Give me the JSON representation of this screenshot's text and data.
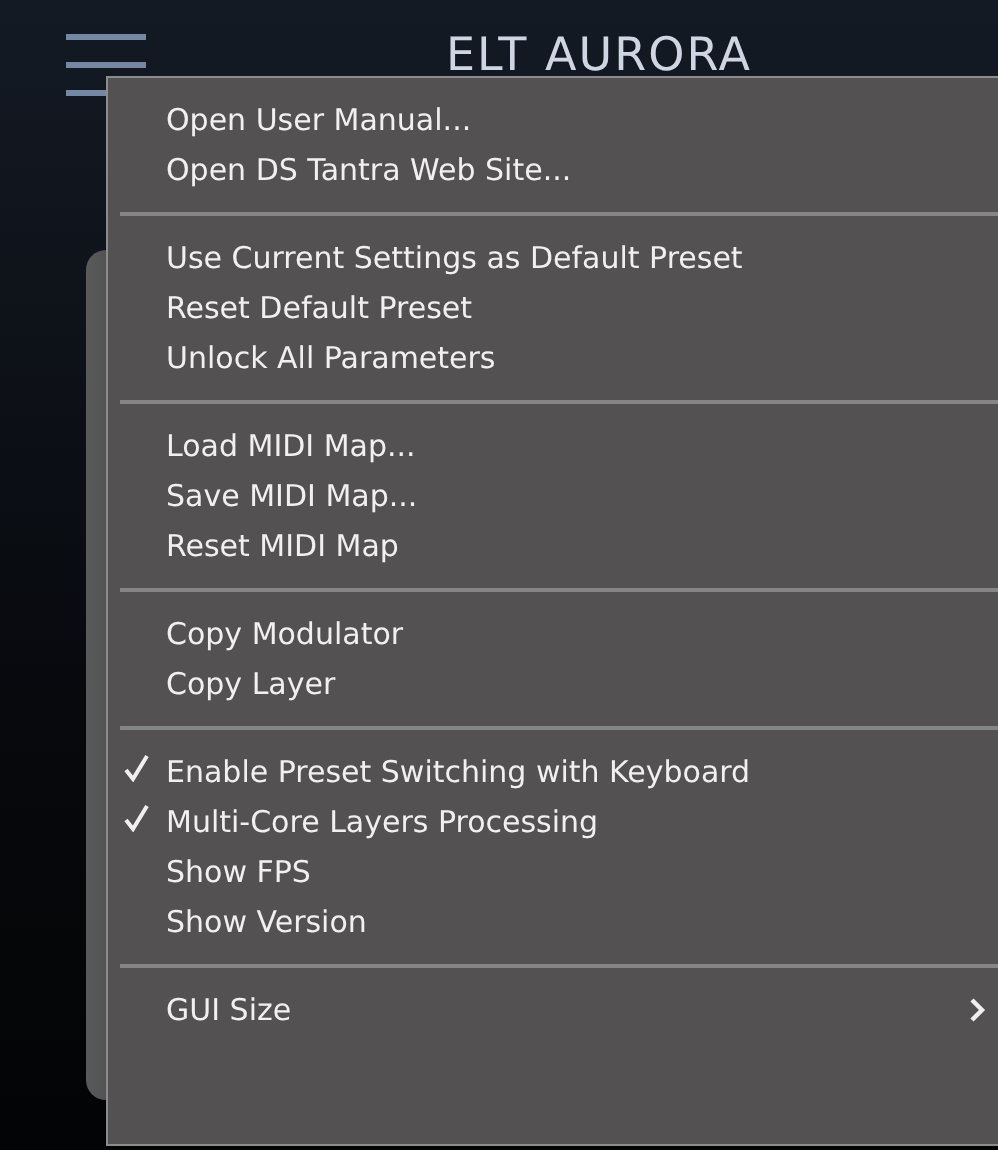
{
  "header": {
    "title": "ELT AURORA"
  },
  "menu": {
    "sections": [
      {
        "items": [
          {
            "label": "Open User Manual...",
            "checked": false
          },
          {
            "label": "Open DS Tantra Web Site...",
            "checked": false
          }
        ]
      },
      {
        "items": [
          {
            "label": "Use Current Settings as Default Preset",
            "checked": false
          },
          {
            "label": "Reset Default Preset",
            "checked": false
          },
          {
            "label": "Unlock All Parameters",
            "checked": false
          }
        ]
      },
      {
        "items": [
          {
            "label": "Load MIDI Map...",
            "checked": false
          },
          {
            "label": "Save MIDI Map...",
            "checked": false
          },
          {
            "label": "Reset MIDI Map",
            "checked": false
          }
        ]
      },
      {
        "items": [
          {
            "label": "Copy Modulator",
            "checked": false
          },
          {
            "label": "Copy Layer",
            "checked": false
          }
        ]
      },
      {
        "items": [
          {
            "label": "Enable Preset Switching with Keyboard",
            "checked": true
          },
          {
            "label": "Multi-Core Layers Processing",
            "checked": true
          },
          {
            "label": "Show FPS",
            "checked": false
          },
          {
            "label": "Show Version",
            "checked": false
          }
        ]
      },
      {
        "items": [
          {
            "label": "GUI Size",
            "checked": false,
            "kind": "submenu"
          }
        ]
      }
    ]
  }
}
